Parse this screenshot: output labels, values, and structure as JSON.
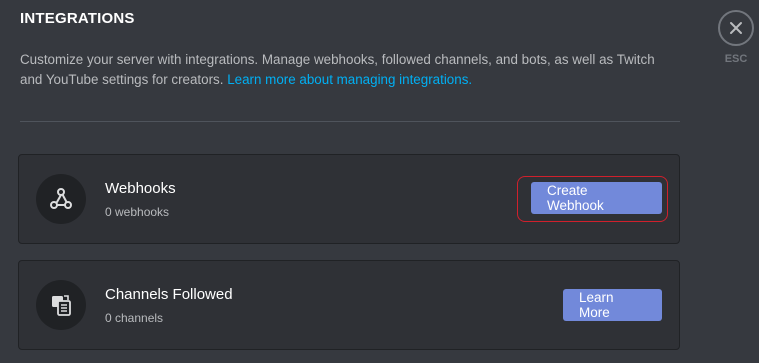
{
  "header": {
    "title": "INTEGRATIONS",
    "description": "Customize your server with integrations. Manage webhooks, followed channels, and bots, as well as Twitch and YouTube settings for creators.",
    "link_text": "Learn more about managing integrations."
  },
  "close": {
    "icon": "close-icon",
    "label": "ESC"
  },
  "cards": {
    "webhooks": {
      "icon": "webhook-icon",
      "title": "Webhooks",
      "subtitle": "0 webhooks",
      "button_label": "Create Webhook"
    },
    "channels": {
      "icon": "channel-follow-icon",
      "title": "Channels Followed",
      "subtitle": "0 channels",
      "button_label": "Learn More"
    }
  },
  "colors": {
    "background": "#36393f",
    "card": "#2f3136",
    "accent": "#7289da",
    "link": "#00b0f4",
    "highlight": "#d0202c"
  }
}
